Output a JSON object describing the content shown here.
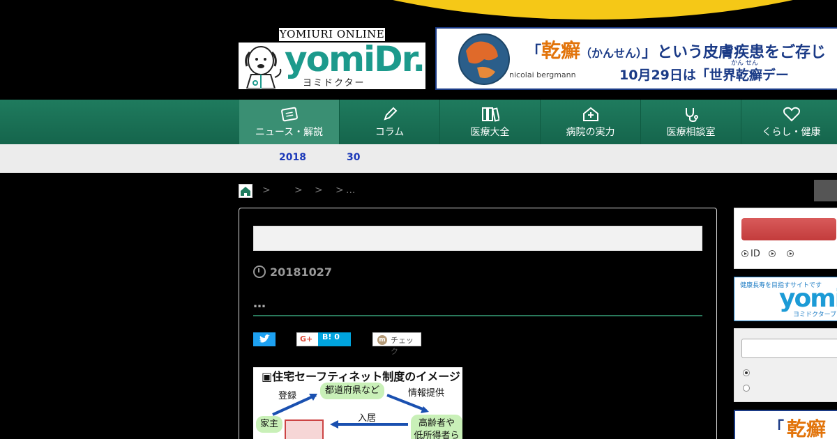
{
  "header": {
    "logo_online": "YOMIURI ONLINE",
    "logo_text": "yomiDr.",
    "logo_sub": "ヨミドクター"
  },
  "banner": {
    "quote_open": "「",
    "keyword": "乾癬",
    "reading": "（かんせん）",
    "rest": "」という皮膚疾患をご存じ",
    "line2": "10月29日は「世界乾癬デー",
    "ruby": "かん せん",
    "brand": "nicolai bergmann"
  },
  "nav": {
    "items": [
      {
        "label": "ニュース・解説",
        "icon": "news-icon"
      },
      {
        "label": "コラム",
        "icon": "pen-icon"
      },
      {
        "label": "医療大全",
        "icon": "books-icon"
      },
      {
        "label": "病院の実力",
        "icon": "hospital-icon"
      },
      {
        "label": "医療相談室",
        "icon": "stethoscope-icon"
      },
      {
        "label": "くらし・健康",
        "icon": "heart-icon"
      }
    ]
  },
  "subbar": {
    "year": "2018",
    "day": "30"
  },
  "breadcrumb": {
    "sep": ">",
    "ellipsis": "..."
  },
  "article": {
    "date": "20181027",
    "dots": "…",
    "share": {
      "gplus": "G+",
      "hatena": "B! 0",
      "mixi_check": "チェック"
    },
    "figure": {
      "title": "住宅セーフティネット制度のイメージ",
      "register": "登録",
      "prefecture": "都道府県など",
      "info": "情報提供",
      "landlord": "家主",
      "move_in": "入居",
      "elderly": "高齢者や",
      "low_income": "低所得者ら"
    }
  },
  "sidebar": {
    "links": [
      "ID",
      "",
      ""
    ],
    "ad_top": "健康長寿を目指すサイトです",
    "ad_brand": "yomi",
    "ad_sub": "ヨミドクターブ",
    "ad2_quote": "「",
    "ad2_keyword": "乾癬"
  },
  "colors": {
    "nav_green": "#1f7b5e",
    "accent_yellow": "#f5c817",
    "link_blue": "#1a38b8",
    "brand_teal": "#1c9a8c"
  }
}
